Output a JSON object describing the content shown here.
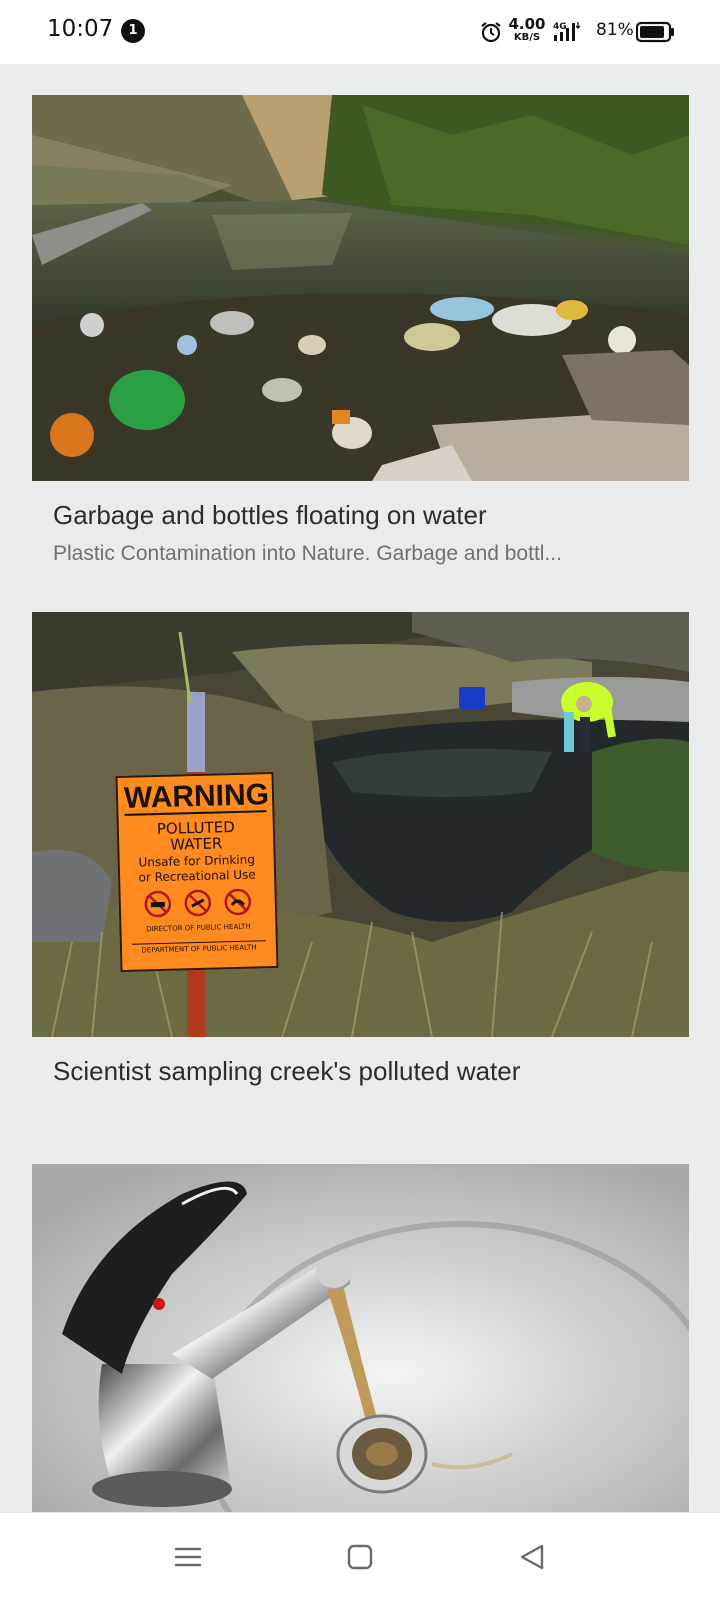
{
  "status_bar": {
    "time": "10:07",
    "notification_count": "1",
    "net_speed_value": "4.00",
    "net_speed_unit": "KB/S",
    "network_type": "4G",
    "battery_percent": "81%"
  },
  "feed": {
    "cards": [
      {
        "title": "Garbage and bottles floating on water",
        "description": "Plastic Contamination into Nature. Garbage and bottl..."
      },
      {
        "title": "Scientist sampling creek's polluted water",
        "sign": {
          "heading": "WARNING",
          "line1": "POLLUTED",
          "line2": "WATER",
          "line3": "Unsafe for Drinking",
          "line4": "or Recreational Use",
          "footer1": "DIRECTOR OF PUBLIC HEALTH",
          "footer2": "DEPARTMENT OF PUBLIC HEALTH"
        }
      },
      {
        "title": ""
      }
    ]
  },
  "nav": {
    "icons": [
      "menu-icon",
      "home-square-icon",
      "back-triangle-icon"
    ]
  },
  "colors": {
    "background": "#e8ecec",
    "status_bar": "#ffffff",
    "sign_orange": "#ff8a1f"
  }
}
